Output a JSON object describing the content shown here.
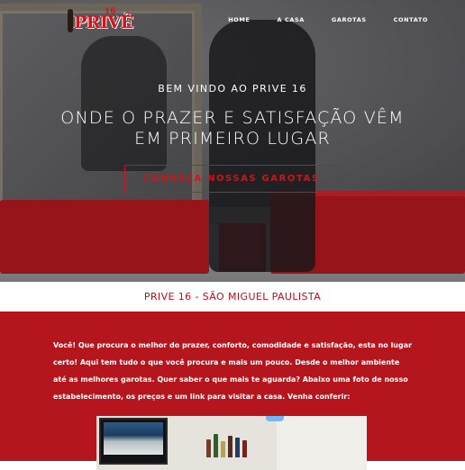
{
  "brand": {
    "logo_text": "PRIVÊ",
    "logo_number": "16"
  },
  "nav": {
    "items": [
      {
        "label": "HOME"
      },
      {
        "label": "A CASA"
      },
      {
        "label": "GAROTAS"
      },
      {
        "label": "CONTATO"
      }
    ]
  },
  "hero": {
    "welcome": "BEM VINDO AO PRIVE 16",
    "headline_line1": "ONDE O PRAZER E SATISFAÇÃO VÊM",
    "headline_line2": "EM PRIMEIRO LUGAR",
    "cta_label": "CONHEÇA NOSSAS GAROTAS"
  },
  "band": {
    "title": "PRIVE 16 - SÃO MIGUEL PAULISTA"
  },
  "content": {
    "paragraph": "Você! Que procura o melhor do prazer, conforto, comodidade e satisfação, esta no lugar certo! Aqui tem tudo o que você procura e mais um pouco. Desde o melhor ambiente até as melhores garotas. Quer saber o que mais te aguarda? Abaixo uma foto de nosso estabelecimento, os preços e um link para visitar a casa. Venha conferir:"
  },
  "colors": {
    "accent_red": "#b5161d",
    "cta_red": "#c9161d",
    "white": "#ffffff"
  }
}
